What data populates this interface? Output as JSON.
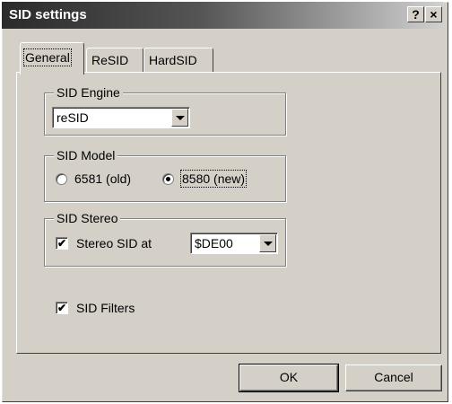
{
  "window": {
    "title": "SID settings",
    "help_label": "?",
    "close_label": "×"
  },
  "tabs": [
    {
      "label": "General",
      "active": true
    },
    {
      "label": "ReSID",
      "active": false
    },
    {
      "label": "HardSID",
      "active": false
    }
  ],
  "engine": {
    "legend": "SID Engine",
    "value": "reSID"
  },
  "model": {
    "legend": "SID Model",
    "options": [
      {
        "label": "6581 (old)",
        "selected": false
      },
      {
        "label": "8580 (new)",
        "selected": true
      }
    ]
  },
  "stereo": {
    "legend": "SID Stereo",
    "checkbox_label": "Stereo SID at",
    "checked": true,
    "address": "$DE00"
  },
  "filters": {
    "label": "SID Filters",
    "checked": true
  },
  "buttons": {
    "ok": "OK",
    "cancel": "Cancel"
  },
  "glyphs": {
    "check": "✔"
  }
}
